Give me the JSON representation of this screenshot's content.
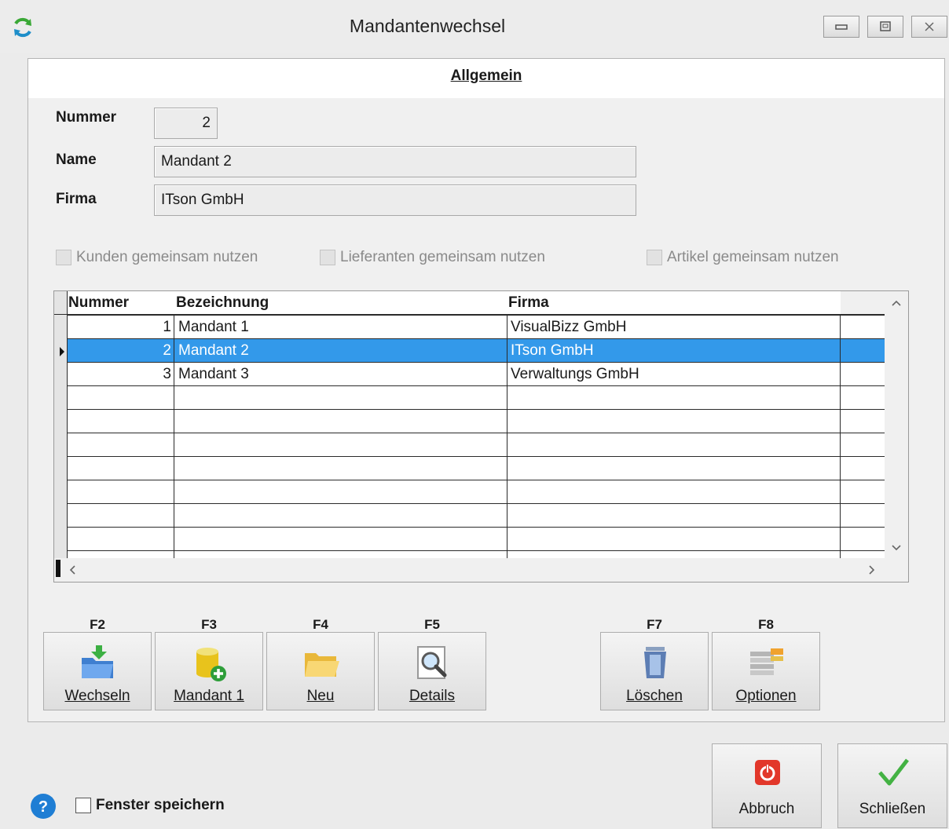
{
  "window": {
    "title": "Mandantenwechsel"
  },
  "tab": {
    "label": "Allgemein"
  },
  "form": {
    "nummer_label": "Nummer",
    "nummer_value": "2",
    "name_label": "Name",
    "name_value": "Mandant 2",
    "firma_label": "Firma",
    "firma_value": "ITson GmbH"
  },
  "options": {
    "kunden": "Kunden gemeinsam nutzen",
    "lieferanten": "Lieferanten gemeinsam nutzen",
    "artikel": "Artikel gemeinsam nutzen"
  },
  "grid": {
    "columns": [
      "Nummer",
      "Bezeichnung",
      "Firma"
    ],
    "rows": [
      {
        "nummer": "1",
        "bezeichnung": "Mandant 1",
        "firma": "VisualBizz GmbH"
      },
      {
        "nummer": "2",
        "bezeichnung": "Mandant 2",
        "firma": "ITson GmbH"
      },
      {
        "nummer": "3",
        "bezeichnung": "Mandant 3",
        "firma": "Verwaltungs GmbH"
      }
    ],
    "selected_row": 2
  },
  "toolbar": {
    "wechseln": {
      "key": "F2",
      "label": "Wechseln"
    },
    "mandant": {
      "key": "F3",
      "label": "Mandant 1"
    },
    "neu": {
      "key": "F4",
      "label": "Neu"
    },
    "details": {
      "key": "F5",
      "label": "Details"
    },
    "loeschen": {
      "key": "F7",
      "label": "Löschen"
    },
    "optionen": {
      "key": "F8",
      "label": "Optionen"
    }
  },
  "footer": {
    "save_window_label": "Fenster speichern",
    "abbruch_label": "Abbruch",
    "schliessen_label": "Schließen"
  },
  "colors": {
    "selection": "#3399ea",
    "accent_green": "#43b243",
    "cancel_red": "#e2372a",
    "help_blue": "#1f7ed4"
  }
}
